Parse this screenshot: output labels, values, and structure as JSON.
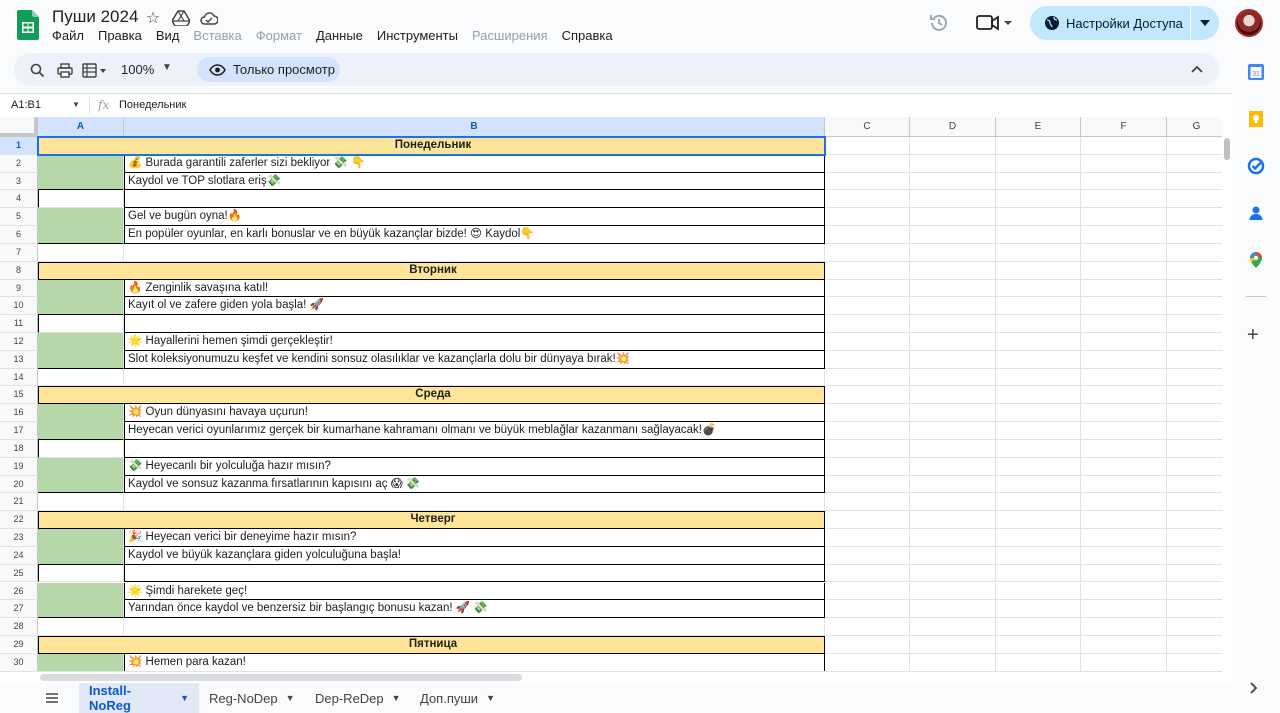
{
  "app": {
    "doc_title": "Пуши 2024",
    "menu": [
      {
        "label": "Файл",
        "disabled": false
      },
      {
        "label": "Правка",
        "disabled": false
      },
      {
        "label": "Вид",
        "disabled": false
      },
      {
        "label": "Вставка",
        "disabled": true
      },
      {
        "label": "Формат",
        "disabled": true
      },
      {
        "label": "Данные",
        "disabled": false
      },
      {
        "label": "Инструменты",
        "disabled": false
      },
      {
        "label": "Расширения",
        "disabled": true
      },
      {
        "label": "Справка",
        "disabled": false
      }
    ],
    "share_label": "Настройки Доступа",
    "colors": {
      "accent": "#0b57d0",
      "share_bg": "#c2e7ff",
      "day_header": "#ffe599",
      "green_cell": "#b6d7a8"
    }
  },
  "toolbar": {
    "zoom": "100%",
    "view_only_label": "Только просмотр"
  },
  "formula_bar": {
    "name_box": "A1:B1",
    "fx_symbol": "fx",
    "value": "Понедельник"
  },
  "grid": {
    "columns": [
      "A",
      "B",
      "C",
      "D",
      "E",
      "F",
      "G"
    ],
    "selected_columns": [
      "A",
      "B"
    ],
    "rows": [
      {
        "n": "1",
        "type": "day",
        "text": "Понедельник"
      },
      {
        "n": "2",
        "type": "green",
        "text": "💰 Burada garantili zaferler sizi bekliyor 💸 👇"
      },
      {
        "n": "3",
        "type": "green",
        "text": "Kaydol ve TOP slotlara eriş💸",
        "last": true
      },
      {
        "n": "4",
        "type": "blank",
        "text": ""
      },
      {
        "n": "5",
        "type": "green",
        "text": "Gel ve bugün oyna!🔥"
      },
      {
        "n": "6",
        "type": "green",
        "text": "En popüler oyunlar, en karlı bonuslar ve en büyük kazançlar bizde! 😍   Kaydol👇",
        "last": true
      },
      {
        "n": "7",
        "type": "empty",
        "text": ""
      },
      {
        "n": "8",
        "type": "day",
        "text": "Вторник"
      },
      {
        "n": "9",
        "type": "green",
        "text": "🔥  Zenginlik savaşına katıl!"
      },
      {
        "n": "10",
        "type": "green",
        "text": "Kayıt ol ve zafere giden yola başla! 🚀",
        "last": true
      },
      {
        "n": "11",
        "type": "blank",
        "text": ""
      },
      {
        "n": "12",
        "type": "green",
        "text": "🌟  Hayallerini hemen şimdi gerçekleştir!"
      },
      {
        "n": "13",
        "type": "green",
        "text": "Slot koleksiyonumuzu keşfet ve kendini sonsuz olasılıklar ve kazançlarla dolu bir dünyaya bırak!💥",
        "last": true
      },
      {
        "n": "14",
        "type": "empty",
        "text": ""
      },
      {
        "n": "15",
        "type": "day",
        "text": "Среда"
      },
      {
        "n": "16",
        "type": "green",
        "text": "💥  Oyun dünyasını havaya uçurun!"
      },
      {
        "n": "17",
        "type": "green",
        "text": "Heyecan verici oyunlarımız gerçek bir kumarhane kahramanı olmanı ve büyük meblağlar kazanmanı sağlayacak!💣",
        "last": true
      },
      {
        "n": "18",
        "type": "blank",
        "text": ""
      },
      {
        "n": "19",
        "type": "green",
        "text": "💸 Heyecanlı bir yolculuğa hazır mısın?"
      },
      {
        "n": "20",
        "type": "green",
        "text": "Kaydol ve sonsuz kazanma fırsatlarının kapısını aç 😱 💸",
        "last": true
      },
      {
        "n": "21",
        "type": "empty",
        "text": ""
      },
      {
        "n": "22",
        "type": "day",
        "text": "Четверг"
      },
      {
        "n": "23",
        "type": "green",
        "text": "🎉  Heyecan verici bir deneyime hazır mısın?"
      },
      {
        "n": "24",
        "type": "green",
        "text": "Kaydol ve büyük kazançlara giden yolculuğuna başla!",
        "last": true
      },
      {
        "n": "25",
        "type": "blank",
        "text": ""
      },
      {
        "n": "26",
        "type": "green",
        "text": "🌟  Şimdi harekete geç!"
      },
      {
        "n": "27",
        "type": "green",
        "text": "Yarından önce kaydol ve benzersiz bir başlangıç bonusu kazan! 🚀 💸",
        "last": true
      },
      {
        "n": "28",
        "type": "empty",
        "text": ""
      },
      {
        "n": "29",
        "type": "day",
        "text": "Пятница"
      },
      {
        "n": "30",
        "type": "green",
        "text": "💥  Hemen para kazan!"
      }
    ]
  },
  "sheets": [
    {
      "label": "Install-NoReg",
      "active": true
    },
    {
      "label": "Reg-NoDep",
      "active": false
    },
    {
      "label": "Dep-ReDep",
      "active": false
    },
    {
      "label": "Доп.пуши",
      "active": false
    }
  ],
  "side_panel": {
    "icons": [
      "calendar-icon",
      "keep-icon",
      "tasks-icon",
      "contacts-icon",
      "maps-icon"
    ]
  }
}
